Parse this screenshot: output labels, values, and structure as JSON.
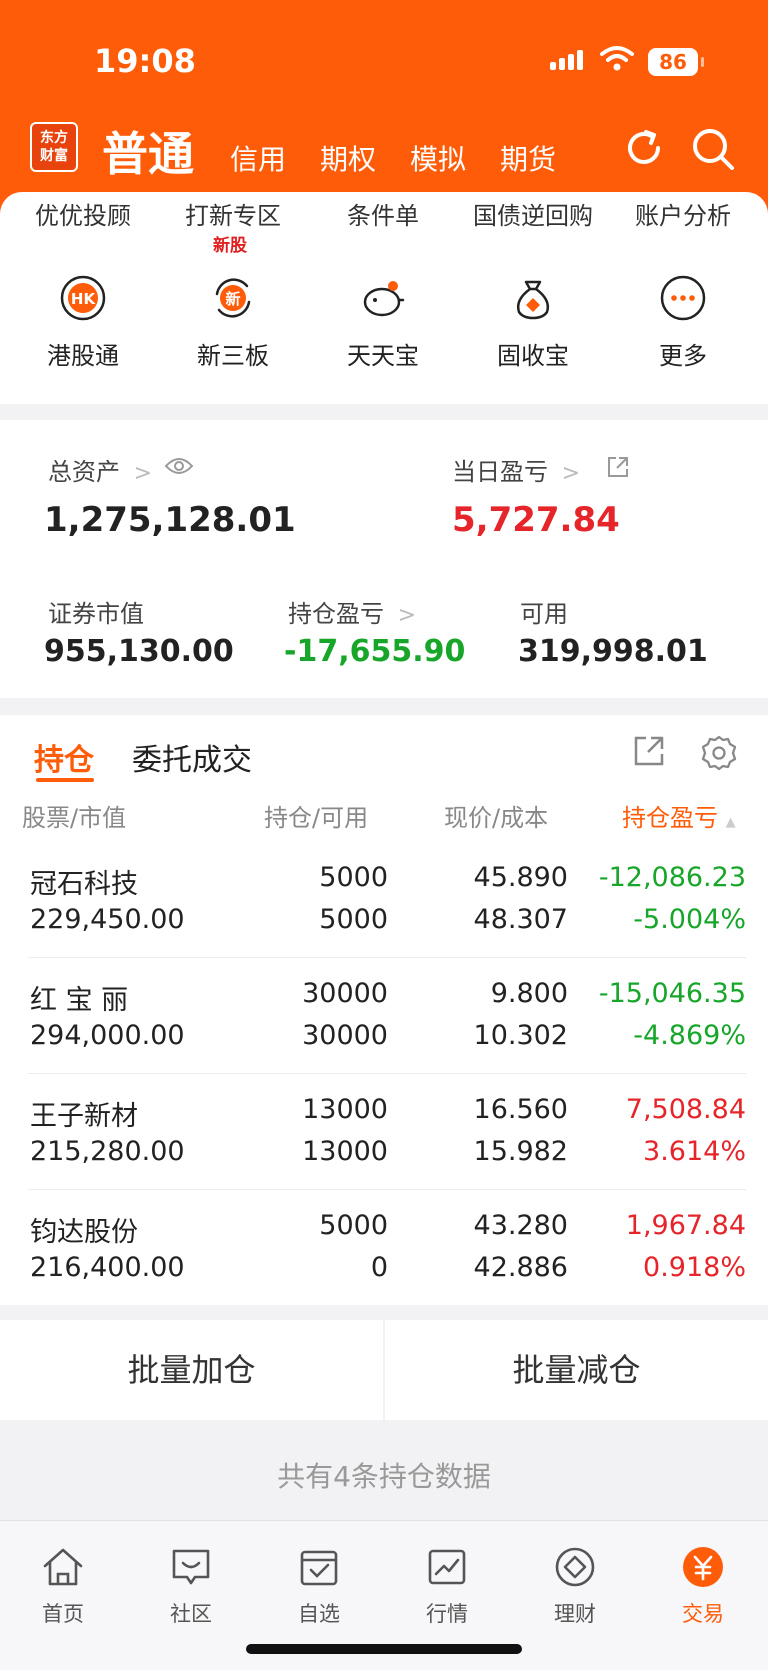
{
  "status_bar": {
    "time": "19:08",
    "battery": "86"
  },
  "header": {
    "logo_text": [
      "东方",
      "财富"
    ],
    "active_account": "普通",
    "account_tabs": [
      "信用",
      "期权",
      "模拟",
      "期货"
    ]
  },
  "quick_menu": {
    "text_row": [
      "优优投顾",
      "打新专区",
      "条件单",
      "国债逆回购",
      "账户分析"
    ],
    "new_badge": "新股",
    "icon_row": [
      {
        "label": "港股通",
        "icon": "hk-icon",
        "glyph": "HK"
      },
      {
        "label": "新三板",
        "icon": "xin-icon",
        "glyph": "新"
      },
      {
        "label": "天天宝",
        "icon": "piggy-bank-icon"
      },
      {
        "label": "固收宝",
        "icon": "money-bag-icon"
      },
      {
        "label": "更多",
        "icon": "more-icon"
      }
    ]
  },
  "assets": {
    "total_label": "总资产",
    "total_value": "1,275,128.01",
    "daily_label": "当日盈亏",
    "daily_value": "5,727.84",
    "market_label": "证券市值",
    "market_value": "955,130.00",
    "position_pl_label": "持仓盈亏",
    "position_pl_value": "-17,655.90",
    "available_label": "可用",
    "available_value": "319,998.01"
  },
  "positions": {
    "tabs": [
      "持仓",
      "委托成交"
    ],
    "columns": [
      "股票/市值",
      "持仓/可用",
      "现价/成本",
      "持仓盈亏"
    ],
    "rows": [
      {
        "name": "冠石科技",
        "market_value": "229,450.00",
        "holding": "5000",
        "available": "5000",
        "price": "45.890",
        "cost": "48.307",
        "pl": "-12,086.23",
        "pl_pct": "-5.004%",
        "trend": "down"
      },
      {
        "name": "红 宝 丽",
        "market_value": "294,000.00",
        "holding": "30000",
        "available": "30000",
        "price": "9.800",
        "cost": "10.302",
        "pl": "-15,046.35",
        "pl_pct": "-4.869%",
        "trend": "down"
      },
      {
        "name": "王子新材",
        "market_value": "215,280.00",
        "holding": "13000",
        "available": "13000",
        "price": "16.560",
        "cost": "15.982",
        "pl": "7,508.84",
        "pl_pct": "3.614%",
        "trend": "up"
      },
      {
        "name": "钧达股份",
        "market_value": "216,400.00",
        "holding": "5000",
        "available": "0",
        "price": "43.280",
        "cost": "42.886",
        "pl": "1,967.84",
        "pl_pct": "0.918%",
        "trend": "up"
      }
    ]
  },
  "batch": {
    "add": "批量加仓",
    "reduce": "批量减仓"
  },
  "summary": "共有4条持仓数据",
  "tabbar": [
    "首页",
    "社区",
    "自选",
    "行情",
    "理财",
    "交易"
  ],
  "colors": {
    "brand": "#ff5c0a",
    "up": "#e5252a",
    "down": "#17a62a"
  }
}
